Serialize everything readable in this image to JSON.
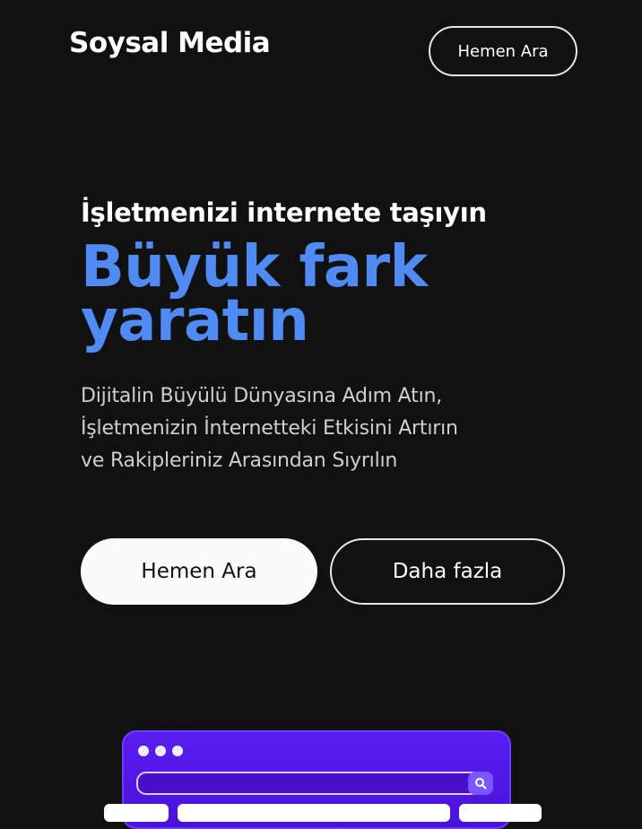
{
  "header": {
    "brand": "Soysal Media",
    "cta_label": "Hemen Ara"
  },
  "hero": {
    "kicker": "İşletmenizi internete taşıyın",
    "headline_line1": "Büyük fark",
    "headline_line2": "yaratın",
    "lede_line1": "Dijitalin Büyülü Dünyasına Adım Atın,",
    "lede_line2": "İşletmenizin İnternetteki Etkisini Artırın",
    "lede_line3": "ve Rakipleriniz Arasından Sıyrılın"
  },
  "actions": {
    "primary_label": "Hemen Ara",
    "secondary_label": "Daha fazla"
  },
  "illustration": {
    "icons": [
      "window-dots-icon",
      "search-icon"
    ]
  },
  "colors": {
    "background": "#111111",
    "accent": "#4f8bf2",
    "illustration": "#5a1df2"
  }
}
